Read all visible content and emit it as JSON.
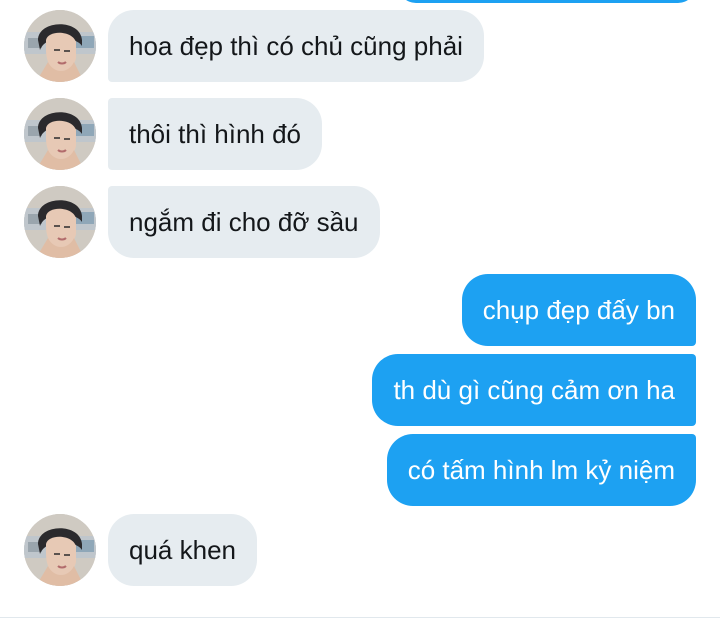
{
  "colors": {
    "outgoing_bubble": "#1da1f2",
    "incoming_bubble": "#e6ecf0",
    "incoming_text": "#14171a",
    "outgoing_text": "#ffffff"
  },
  "avatar_icon": "user-avatar",
  "messages": [
    {
      "direction": "incoming",
      "text": "hoa đẹp thì có chủ cũng phải"
    },
    {
      "direction": "incoming",
      "text": "thôi thì hình đó"
    },
    {
      "direction": "incoming",
      "text": "ngắm đi cho đỡ sầu"
    },
    {
      "direction": "outgoing",
      "text": "chụp đẹp đấy bn"
    },
    {
      "direction": "outgoing",
      "text": "th dù gì cũng cảm ơn ha"
    },
    {
      "direction": "outgoing",
      "text": "có tấm hình lm kỷ niệm"
    },
    {
      "direction": "incoming",
      "text": "quá khen"
    }
  ]
}
